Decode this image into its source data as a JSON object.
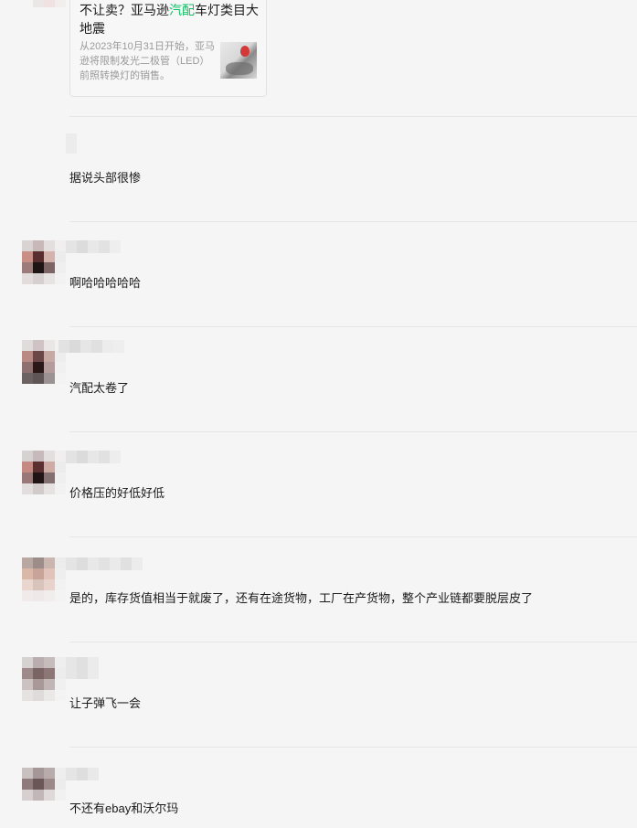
{
  "link_card": {
    "title_before": "不让卖？亚马逊",
    "title_highlight": "汽配",
    "title_after": "车灯类目大地震",
    "description": "从2023年10月31日开始，亚马逊将限制发光二极管（LED）前照转换灯的销售。",
    "highlight_color": "#07c160"
  },
  "comments": [
    {
      "text": "据说头部很惨"
    },
    {
      "text": "啊哈哈哈哈哈"
    },
    {
      "text": "汽配太卷了"
    },
    {
      "text": "价格压的好低好低"
    },
    {
      "text": "是的，库存货值相当于就废了，还有在途货物，工厂在产货物，整个产业链都要脱层皮了"
    },
    {
      "text": "让子弹飞一会"
    },
    {
      "text": "不还有ebay和沃尔玛"
    }
  ],
  "colors": {
    "background": "#f5f5f5",
    "divider": "#e6e6e6",
    "text": "#1a1a1a",
    "muted": "#9a9a9a"
  }
}
